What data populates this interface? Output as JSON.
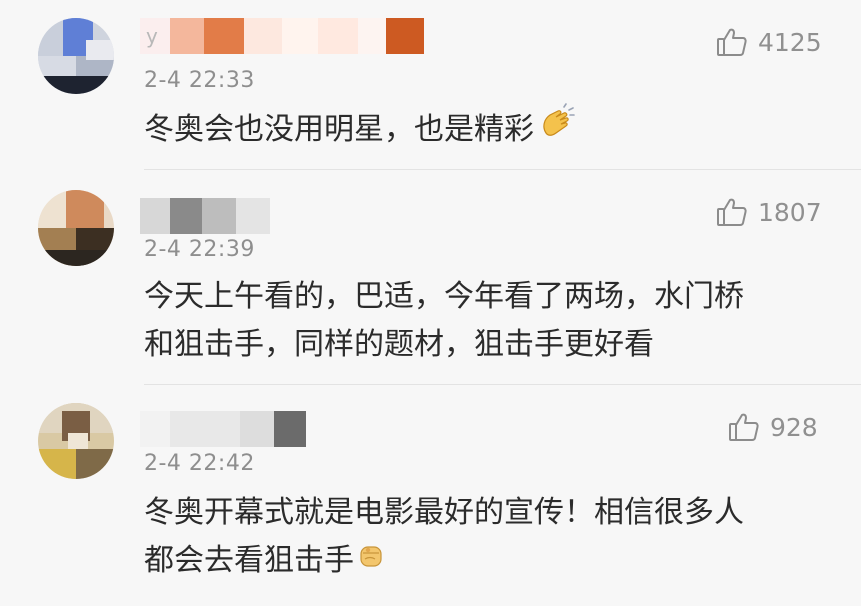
{
  "comments": [
    {
      "username_fragment": "y",
      "timestamp": "2-4 22:33",
      "likes": "4125",
      "text": "冬奥会也没用明星，也是精彩",
      "emoji": "clapping-hands"
    },
    {
      "username_fragment": "",
      "timestamp": "2-4 22:39",
      "likes": "1807",
      "text_line1": "今天上午看的，巴适，今年看了两场，水门桥",
      "text_line2": "和狙击手，同样的题材，狙击手更好看"
    },
    {
      "username_fragment": "",
      "timestamp": "2-4 22:42",
      "likes": "928",
      "text_line1": "冬奥开幕式就是电影最好的宣传！相信很多人",
      "text_line2": "都会去看狙击手",
      "emoji": "raised-fist"
    }
  ],
  "colors": {
    "background": "#f7f7f7",
    "text": "#2b2b2b",
    "meta": "#8e8e8e",
    "divider": "#e3e3e3"
  }
}
